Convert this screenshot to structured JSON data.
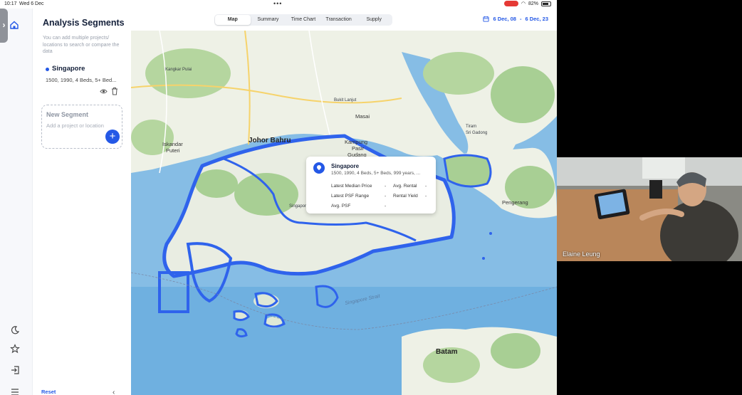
{
  "status_bar": {
    "time": "10:17",
    "date": "Wed 6 Dec",
    "battery": "82%"
  },
  "sidebar": {
    "title": "Analysis Segments",
    "description": "You can add multiple projects/ locations to search or compare the data",
    "segment": {
      "name": "Singapore",
      "detail": "1500, 1990, 4 Beds, 5+ Bed..."
    },
    "new_segment": {
      "title": "New Segment",
      "placeholder": "Add a project or location"
    },
    "reset_label": "Reset"
  },
  "tabs": [
    {
      "label": "Map",
      "active": true
    },
    {
      "label": "Summary",
      "active": false
    },
    {
      "label": "Time Chart",
      "active": false
    },
    {
      "label": "Transaction",
      "active": false
    },
    {
      "label": "Supply",
      "active": false
    }
  ],
  "date_range": {
    "start": "6 Dec, 08",
    "separator": "-",
    "end": "6 Dec, 23"
  },
  "map_labels": {
    "johor": "Johor Bahru",
    "kampung": "Kampung",
    "pasir": "Pasir",
    "gudang": "Gudang",
    "iskandar": "Iskandar",
    "puteri": "Puteri",
    "masai": "Masai",
    "batam": "Batam",
    "pengerang": "Pengerang",
    "kangkar": "Kangkar Pulai",
    "singapore_strait": "Singapore Strait",
    "sg_island": "Singapore Island",
    "bukit": "Bukit Lanjut",
    "tiram": "Tiram",
    "sri": "Sri Gadong"
  },
  "popup": {
    "title": "Singapore",
    "subtitle": "1500, 1990, 4 Beds, 5+ Beds, 999 years, ...",
    "latest_median_price": {
      "label": "Latest Median Price",
      "value": "-"
    },
    "avg_rental": {
      "label": "Avg. Rental",
      "value": "-"
    },
    "latest_psf_range": {
      "label": "Latest PSF Range",
      "value": "-"
    },
    "rental_yield": {
      "label": "Rental Yield",
      "value": "-"
    },
    "avg_psf": {
      "label": "Avg. PSF",
      "value": "-"
    }
  },
  "video": {
    "participant_name": "Elaine Leung"
  },
  "colors": {
    "accent": "#2458e6",
    "water": "#7fb6e2",
    "land": "#eef1e6",
    "park": "#a8cf94"
  }
}
